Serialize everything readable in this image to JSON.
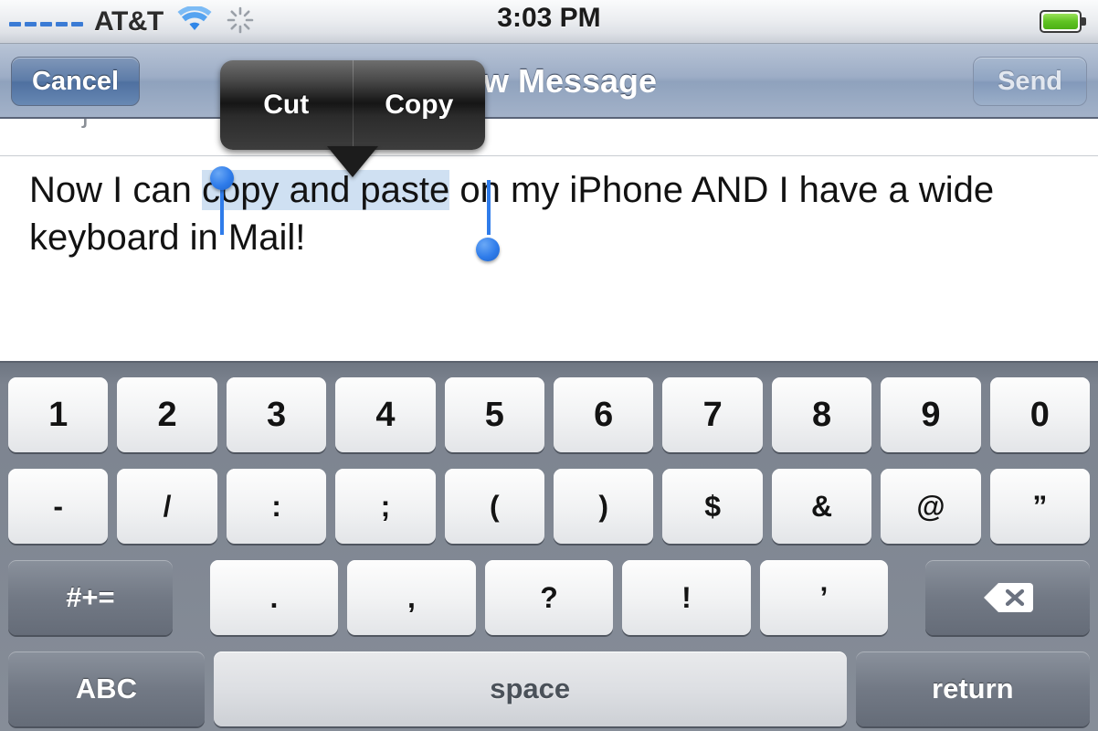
{
  "status_bar": {
    "signal_dots": 5,
    "carrier": "AT&T",
    "wifi_icon": "wifi-icon",
    "activity_icon": "activity-spinner-icon",
    "time": "3:03 PM",
    "battery_icon": "battery-full-icon",
    "battery_color": "#5fc322"
  },
  "nav_bar": {
    "cancel_label": "Cancel",
    "title": "New Message",
    "send_label": "Send",
    "accent_color": "#5d7ca8"
  },
  "compose": {
    "partial_field_text": "j",
    "message_before": "Now I can ",
    "message_selected": "copy and paste",
    "message_after": " on my iPhone AND I have a wide keyboard in Mail!",
    "selection_color": "#cfe0f2",
    "handle_color": "#2f7cea"
  },
  "edit_menu": {
    "items": [
      {
        "label": "Cut"
      },
      {
        "label": "Copy"
      }
    ]
  },
  "keyboard": {
    "row1": [
      "1",
      "2",
      "3",
      "4",
      "5",
      "6",
      "7",
      "8",
      "9",
      "0"
    ],
    "row2": [
      "-",
      "/",
      ":",
      ";",
      "(",
      ")",
      "$",
      "&",
      "@",
      "”"
    ],
    "row3": {
      "symbol_key": "#+=",
      "keys": [
        ".",
        ",",
        "?",
        "!",
        "’"
      ],
      "backspace_icon": "backspace-delete-icon"
    },
    "row4": {
      "abc_key": "ABC",
      "space_key": "space",
      "return_key": "return"
    }
  }
}
